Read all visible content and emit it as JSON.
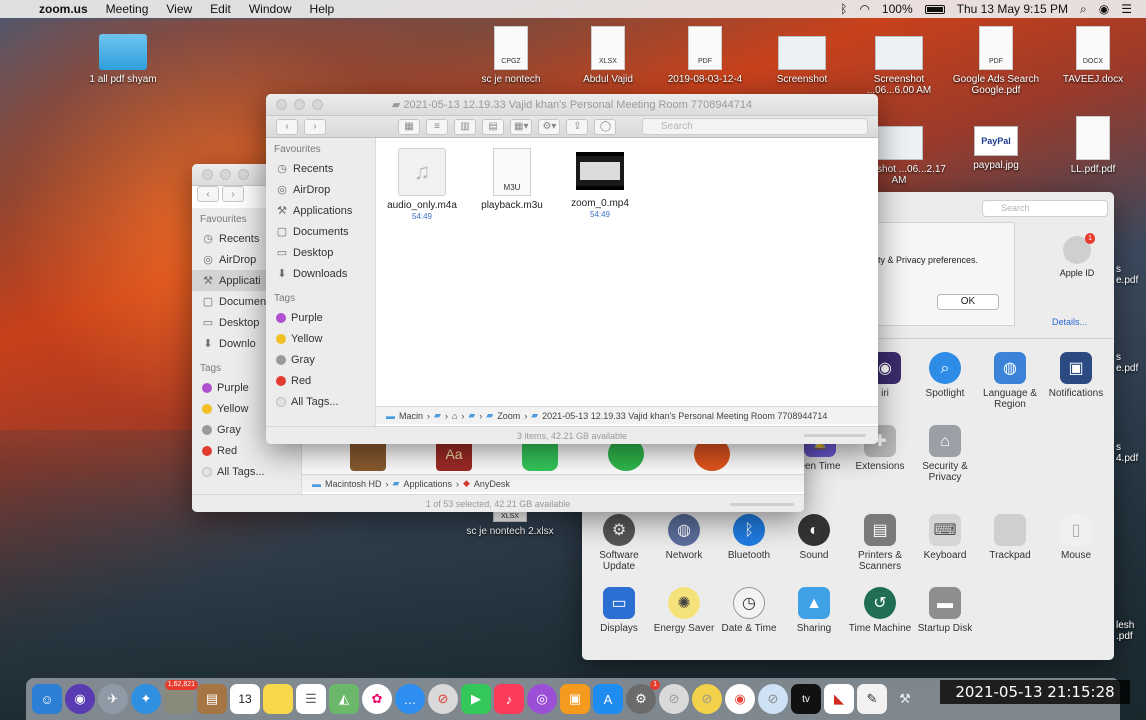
{
  "menubar": {
    "app": "zoom.us",
    "items": [
      "Meeting",
      "View",
      "Edit",
      "Window",
      "Help"
    ],
    "battery": "100%",
    "datetime": "Thu 13 May  9:15 PM"
  },
  "desktop_icons": [
    {
      "label": "1 all pdf shyam",
      "kind": "folder"
    },
    {
      "label": "sc je nontech",
      "kind": "doc",
      "ext": "CPGZ"
    },
    {
      "label": "Abdul Vajid",
      "kind": "doc",
      "ext": "XLSX"
    },
    {
      "label": "2019-08-03-12-4",
      "kind": "doc",
      "ext": "PDF"
    },
    {
      "label": "Screenshot",
      "kind": "shot"
    },
    {
      "label": "Screenshot ...06...6.00 AM",
      "kind": "shot"
    },
    {
      "label": "Google Ads Search Google.pdf",
      "kind": "doc",
      "ext": "PDF"
    },
    {
      "label": "TAVEEJ.docx",
      "kind": "doc",
      "ext": "DOCX"
    },
    {
      "label": "creenshot ...06...2.17 AM",
      "kind": "shot"
    },
    {
      "label": "paypal.jpg",
      "kind": "paypal",
      "ext": "PayPal"
    },
    {
      "label": "LL.pdf.pdf",
      "kind": "doc",
      "ext": ""
    },
    {
      "label": "sc je nontech 2.xlsx",
      "kind": "doc",
      "ext": "XLSX"
    }
  ],
  "finder_front": {
    "title": "2021-05-13 12.19.33 Vajid khan's Personal Meeting Room 7708944714",
    "search_placeholder": "Search",
    "favourites_label": "Favourites",
    "favourites": [
      "Recents",
      "AirDrop",
      "Applications",
      "Documents",
      "Desktop",
      "Downloads"
    ],
    "tags_label": "Tags",
    "tags": [
      {
        "name": "Purple",
        "color": "#b04fd0"
      },
      {
        "name": "Yellow",
        "color": "#f2c025"
      },
      {
        "name": "Gray",
        "color": "#9a9a9a"
      },
      {
        "name": "Red",
        "color": "#e23b30"
      },
      {
        "name": "All Tags...",
        "color": "#e2e2e2"
      }
    ],
    "files": [
      {
        "name": "audio_only.m4a",
        "duration": "54:49",
        "kind": "audio"
      },
      {
        "name": "playback.m3u",
        "duration": "",
        "kind": "m3u",
        "badge": "M3U"
      },
      {
        "name": "zoom_0.mp4",
        "duration": "54:49",
        "kind": "video"
      }
    ],
    "path": [
      "Macin",
      "Zoom",
      "2021-05-13 12.19.33 Vajid khan's Personal Meeting Room 7708944714"
    ],
    "status": "3 items, 42.21 GB available"
  },
  "finder_back": {
    "favourites_label": "Favourites",
    "favourites": [
      "Recents",
      "AirDrop",
      "Applicati",
      "Documen",
      "Desktop",
      "Downlo"
    ],
    "tags_label": "Tags",
    "tags": [
      {
        "name": "Purple",
        "color": "#b04fd0"
      },
      {
        "name": "Yellow",
        "color": "#f2c025"
      },
      {
        "name": "Gray",
        "color": "#9a9a9a"
      },
      {
        "name": "Red",
        "color": "#e23b30"
      },
      {
        "name": "All Tags...",
        "color": "#e2e2e2"
      }
    ],
    "path": [
      "Macintosh HD",
      "Applications",
      "AnyDesk"
    ],
    "status": "1 of 53 selected, 42.21 GB available"
  },
  "prefs": {
    "search_placeholder": "Search",
    "alert_text": "rity & Privacy preferences.",
    "ok_label": "OK",
    "apple_id_label": "Apple ID",
    "apple_id_badge": "1",
    "details_label": "Details...",
    "row2": [
      "iri",
      "Spotlight",
      "Language & Region",
      "Notifications"
    ],
    "row3": [
      "een Time",
      "Extensions",
      "Security & Privacy"
    ],
    "row4": [
      "Software Update",
      "Network",
      "Bluetooth",
      "Sound",
      "Printers & Scanners",
      "Keyboard",
      "Trackpad",
      "Mouse"
    ],
    "row5": [
      "Displays",
      "Energy Saver",
      "Date & Time",
      "Sharing",
      "Time Machine",
      "Startup Disk"
    ],
    "right_edge_labels": [
      "s e.pdf",
      "s e.pdf",
      "s 4.pdf",
      "lesh .pdf"
    ]
  },
  "dock": {
    "badge_text": "1,62,821",
    "calendar_day": "13",
    "sysprefs_badge": "1"
  },
  "overlay_clock": "2021-05-13  21:15:28"
}
